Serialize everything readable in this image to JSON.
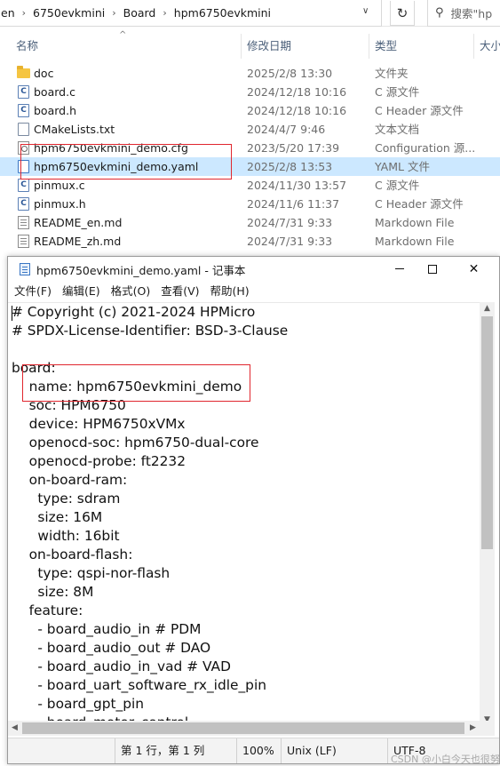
{
  "explorer": {
    "breadcrumbs": [
      "en",
      "6750evkmini",
      "Board",
      "hpm6750evkmini"
    ],
    "search_placeholder": "搜索\"hp",
    "columns": {
      "name": "名称",
      "date": "修改日期",
      "type": "类型",
      "size": "大小"
    },
    "files": [
      {
        "name": "doc",
        "date": "2025/2/8 13:30",
        "type": "文件夹",
        "icon": "folder-icon"
      },
      {
        "name": "board.c",
        "date": "2024/12/18 10:16",
        "type": "C 源文件",
        "icon": "c-file-icon"
      },
      {
        "name": "board.h",
        "date": "2024/12/18 10:16",
        "type": "C Header 源文件",
        "icon": "c-header-icon"
      },
      {
        "name": "CMakeLists.txt",
        "date": "2024/4/7 9:46",
        "type": "文本文档",
        "icon": "text-file-icon"
      },
      {
        "name": "hpm6750evkmini_demo.cfg",
        "date": "2023/5/20 17:39",
        "type": "Configuration 源...",
        "icon": "config-file-icon"
      },
      {
        "name": "hpm6750evkmini_demo.yaml",
        "date": "2025/2/8 13:53",
        "type": "YAML 文件",
        "icon": "yaml-file-icon",
        "selected": true
      },
      {
        "name": "pinmux.c",
        "date": "2024/11/30 13:57",
        "type": "C 源文件",
        "icon": "c-file-icon"
      },
      {
        "name": "pinmux.h",
        "date": "2024/11/6 11:37",
        "type": "C Header 源文件",
        "icon": "c-header-icon"
      },
      {
        "name": "README_en.md",
        "date": "2024/7/31 9:33",
        "type": "Markdown File",
        "icon": "markdown-file-icon"
      },
      {
        "name": "README_zh.md",
        "date": "2024/7/31 9:33",
        "type": "Markdown File",
        "icon": "markdown-file-icon"
      }
    ]
  },
  "notepad": {
    "title": "hpm6750evkmini_demo.yaml - 记事本",
    "menu": [
      "文件(F)",
      "编辑(E)",
      "格式(O)",
      "查看(V)",
      "帮助(H)"
    ],
    "content_lines": [
      "# Copyright (c) 2021-2024 HPMicro",
      "# SPDX-License-Identifier: BSD-3-Clause",
      "",
      "board:",
      "    name: hpm6750evkmini_demo",
      "    soc: HPM6750",
      "    device: HPM6750xVMx",
      "    openocd-soc: hpm6750-dual-core",
      "    openocd-probe: ft2232",
      "    on-board-ram:",
      "      type: sdram",
      "      size: 16M",
      "      width: 16bit",
      "    on-board-flash:",
      "      type: qspi-nor-flash",
      "      size: 8M",
      "    feature:",
      "      - board_audio_in # PDM",
      "      - board_audio_out # DAO",
      "      - board_audio_in_vad # VAD",
      "      - board_uart_software_rx_idle_pin",
      "      - board_gpt_pin",
      "      - board_motor_control"
    ],
    "status": {
      "position": "第 1 行，第 1 列",
      "zoom": "100%",
      "line_ending": "Unix (LF)",
      "encoding": "UTF-8"
    }
  },
  "watermark": "CSDN @小白今天也很努",
  "colors": {
    "highlight": "#e0262e",
    "selection": "#cce8ff"
  }
}
